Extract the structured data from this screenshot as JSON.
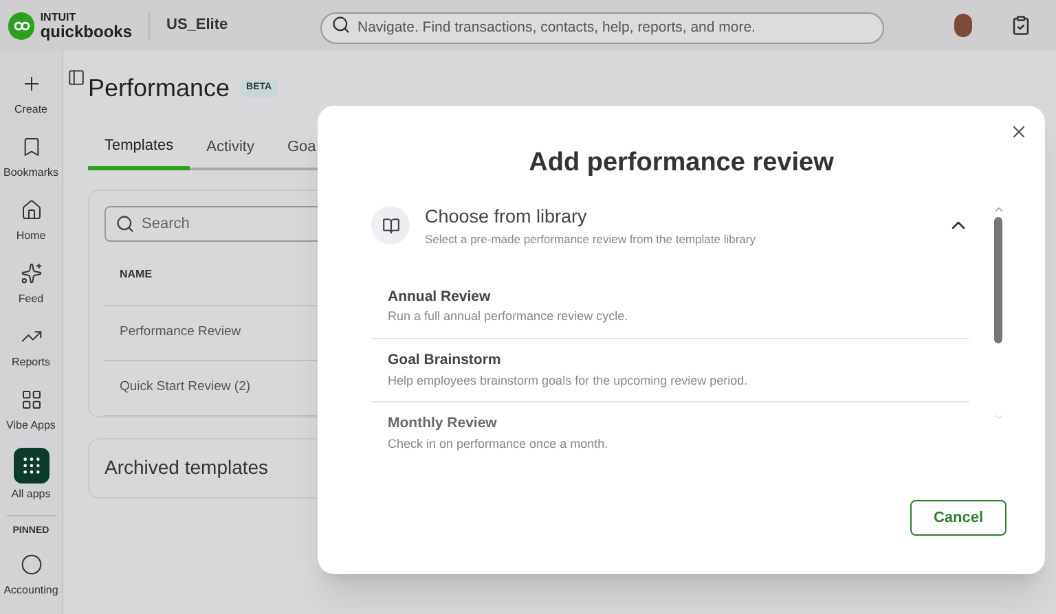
{
  "brand": {
    "top": "INTUIT",
    "bottom": "quickbooks"
  },
  "company": "US_Elite",
  "search": {
    "placeholder": "Navigate. Find transactions, contacts, help, reports, and more."
  },
  "sidebar": {
    "items": [
      {
        "kind": "plus",
        "label": "Create",
        "selected": false
      },
      {
        "kind": "bookmark",
        "label": "Bookmarks",
        "selected": false
      },
      {
        "kind": "home",
        "label": "Home",
        "selected": false
      },
      {
        "kind": "sparkle",
        "label": "Feed",
        "selected": false
      },
      {
        "kind": "chart",
        "label": "Reports",
        "selected": false
      },
      {
        "kind": "grid",
        "label": "Vibe Apps",
        "selected": false
      },
      {
        "kind": "dots",
        "label": "All apps",
        "selected": true
      }
    ],
    "pinned_heading": "PINNED",
    "pinned": [
      {
        "kind": "circle",
        "label": "Accounting",
        "selected": false
      }
    ]
  },
  "page": {
    "title": "Performance",
    "badge": "BETA",
    "tabs": [
      {
        "label": "Templates",
        "selected": true
      },
      {
        "label": "Activity",
        "selected": false
      },
      {
        "label": "Goa",
        "selected": false
      }
    ],
    "table_search": {
      "placeholder": "Search"
    },
    "table": {
      "columns": [
        "NAME"
      ],
      "rows": [
        [
          "Performance Review"
        ],
        [
          "Quick Start Review (2)"
        ]
      ]
    },
    "archived": {
      "title": "Archived templates"
    }
  },
  "dialog": {
    "title": "Add performance review",
    "section": {
      "title": "Choose from library",
      "subtitle": "Select a pre-made performance review from the template library",
      "expanded": true
    },
    "items": [
      {
        "title": "Annual Review",
        "description": "Run a full annual performance review cycle.",
        "faded": false
      },
      {
        "title": "Goal Brainstorm",
        "description": "Help employees brainstorm goals for the upcoming review period.",
        "faded": false
      },
      {
        "title": "Monthly Review",
        "description": "Check in on performance once a month.",
        "faded": true
      }
    ],
    "buttons": [
      {
        "label": "Cancel"
      }
    ]
  }
}
